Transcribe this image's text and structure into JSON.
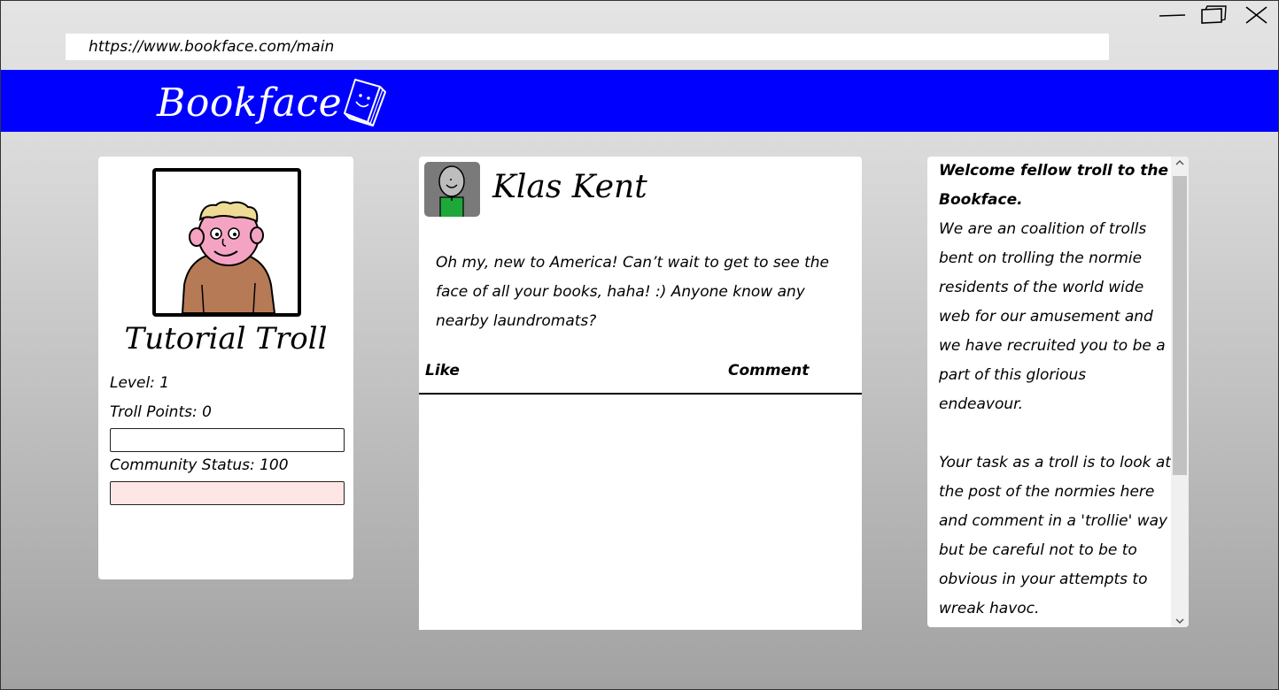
{
  "browser": {
    "url": "https://www.bookface.com/main"
  },
  "brand": {
    "name": "Bookface",
    "accent_color": "#0000ff"
  },
  "profile": {
    "name": "Tutorial Troll",
    "level": "Level: 1",
    "troll_points": "Troll Points: 0",
    "troll_points_fill": 0,
    "community_status": "Community Status: 100",
    "community_status_fill": 1.0,
    "community_status_color": "#ffe6e6"
  },
  "post": {
    "author": "Klas Kent",
    "body": "Oh my, new to America! Can’t wait to get to see the face of all your books, haha! :) Anyone know any nearby laundromats?",
    "like_label": "Like",
    "comment_label": "Comment"
  },
  "info": {
    "title": "Welcome fellow troll to the Bookface.",
    "paragraph1": "We are an coalition of trolls bent on trolling the normie residents of the world wide web for our amusement and we have recruited you to be a part of this glorious endeavour.",
    "paragraph2": "Your task as a troll is to look at the post of the normies here and comment in a 'trollie' way but be careful not to be to obvious in your attempts to wreak havoc."
  },
  "icons": {
    "minimize": "minimize-icon",
    "maximize": "maximize-icon",
    "close": "close-icon",
    "logo": "book-icon",
    "scroll_up": "chevron-up-icon",
    "scroll_down": "chevron-down-icon"
  }
}
